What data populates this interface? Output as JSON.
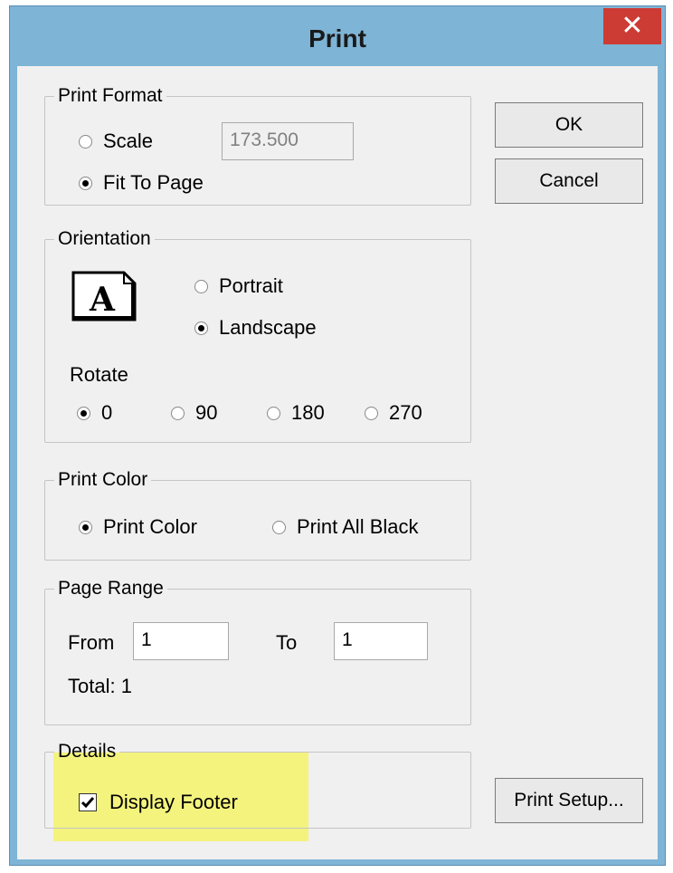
{
  "window": {
    "title": "Print",
    "close_symbol": "✕"
  },
  "print_format": {
    "legend": "Print Format",
    "scale_label": "Scale",
    "scale_value": "173.500",
    "fit_label": "Fit To Page",
    "selected": "Fit To Page"
  },
  "buttons": {
    "ok": "OK",
    "cancel": "Cancel",
    "print_setup": "Print Setup..."
  },
  "orientation": {
    "legend": "Orientation",
    "icon_letter": "A",
    "portrait_label": "Portrait",
    "landscape_label": "Landscape",
    "selected": "Landscape",
    "rotate_label": "Rotate",
    "rotate_options": [
      "0",
      "90",
      "180",
      "270"
    ],
    "rotate_selected": "0"
  },
  "print_color": {
    "legend": "Print Color",
    "color_label": "Print Color",
    "black_label": "Print All Black",
    "selected": "Print Color"
  },
  "page_range": {
    "legend": "Page Range",
    "from_label": "From",
    "from_value": "1",
    "to_label": "To",
    "to_value": "1",
    "total_label": "Total: 1"
  },
  "details": {
    "legend": "Details",
    "display_footer_label": "Display Footer",
    "display_footer_checked": true
  },
  "colors": {
    "title_bar": "#7eb4d6",
    "close_button": "#cc3b34",
    "highlight": "#f4f36a"
  }
}
